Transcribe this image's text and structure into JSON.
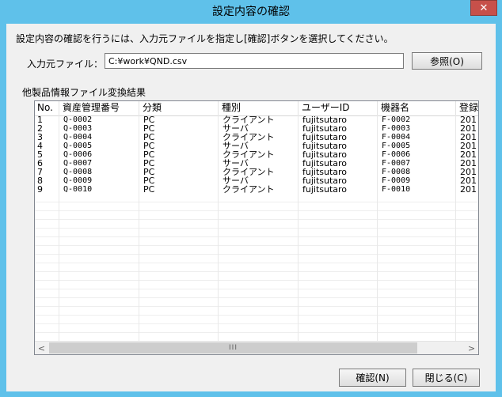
{
  "window": {
    "title": "設定内容の確認",
    "close_glyph": "✕"
  },
  "instruction": "設定内容の確認を行うには、入力元ファイルを指定し[確認]ボタンを選択してください。",
  "file": {
    "label": "入力元ファイル：",
    "value": "C:¥work¥QND.csv",
    "browse_label": "参照(O)"
  },
  "results": {
    "label": "他製品情報ファイル変換結果",
    "columns": [
      "No.",
      "資産管理番号",
      "分類",
      "種別",
      "ユーザーID",
      "機器名",
      "登録"
    ],
    "rows": [
      [
        "1",
        "Q-0002",
        "PC",
        "クライアント",
        "fujitsutaro",
        "F-0002",
        "201"
      ],
      [
        "2",
        "Q-0003",
        "PC",
        "サーバ",
        "fujitsutaro",
        "F-0003",
        "201"
      ],
      [
        "3",
        "Q-0004",
        "PC",
        "クライアント",
        "fujitsutaro",
        "F-0004",
        "201"
      ],
      [
        "4",
        "Q-0005",
        "PC",
        "サーバ",
        "fujitsutaro",
        "F-0005",
        "201"
      ],
      [
        "5",
        "Q-0006",
        "PC",
        "クライアント",
        "fujitsutaro",
        "F-0006",
        "201"
      ],
      [
        "6",
        "Q-0007",
        "PC",
        "サーバ",
        "fujitsutaro",
        "F-0007",
        "201"
      ],
      [
        "7",
        "Q-0008",
        "PC",
        "クライアント",
        "fujitsutaro",
        "F-0008",
        "201"
      ],
      [
        "8",
        "Q-0009",
        "PC",
        "サーバ",
        "fujitsutaro",
        "F-0009",
        "201"
      ],
      [
        "9",
        "Q-0010",
        "PC",
        "クライアント",
        "fujitsutaro",
        "F-0010",
        "201"
      ]
    ],
    "scroll": {
      "left_glyph": "<",
      "right_glyph": ">",
      "thumb_glyph": "III"
    }
  },
  "buttons": {
    "ok": "確認(N)",
    "close": "閉じる(C)"
  },
  "colors": {
    "titlebar": "#5fc1ea",
    "close_button": "#c7504a",
    "dialog_bg": "#f0f0f0"
  }
}
